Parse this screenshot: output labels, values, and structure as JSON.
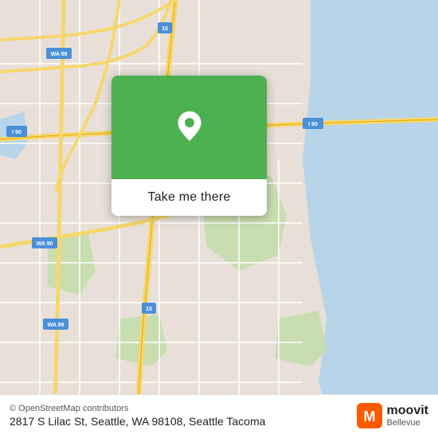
{
  "map": {
    "background_color": "#e8e0d8",
    "water_color": "#b8d4e8",
    "park_color": "#c8ddb0",
    "highway_color": "#f5d76e"
  },
  "card": {
    "button_label": "Take me there",
    "pin_color": "#4CAF50"
  },
  "bottom_bar": {
    "copyright": "© OpenStreetMap contributors",
    "address": "2817 S Lilac St, Seattle, WA 98108, Seattle Tacoma",
    "moovit_label": "moovit",
    "moovit_sublabel": "Bellevue"
  },
  "badges": {
    "i90_label": "I 90",
    "wa15_label": "15",
    "wa99_label": "WA 99",
    "wa90_label": "WA 90"
  }
}
